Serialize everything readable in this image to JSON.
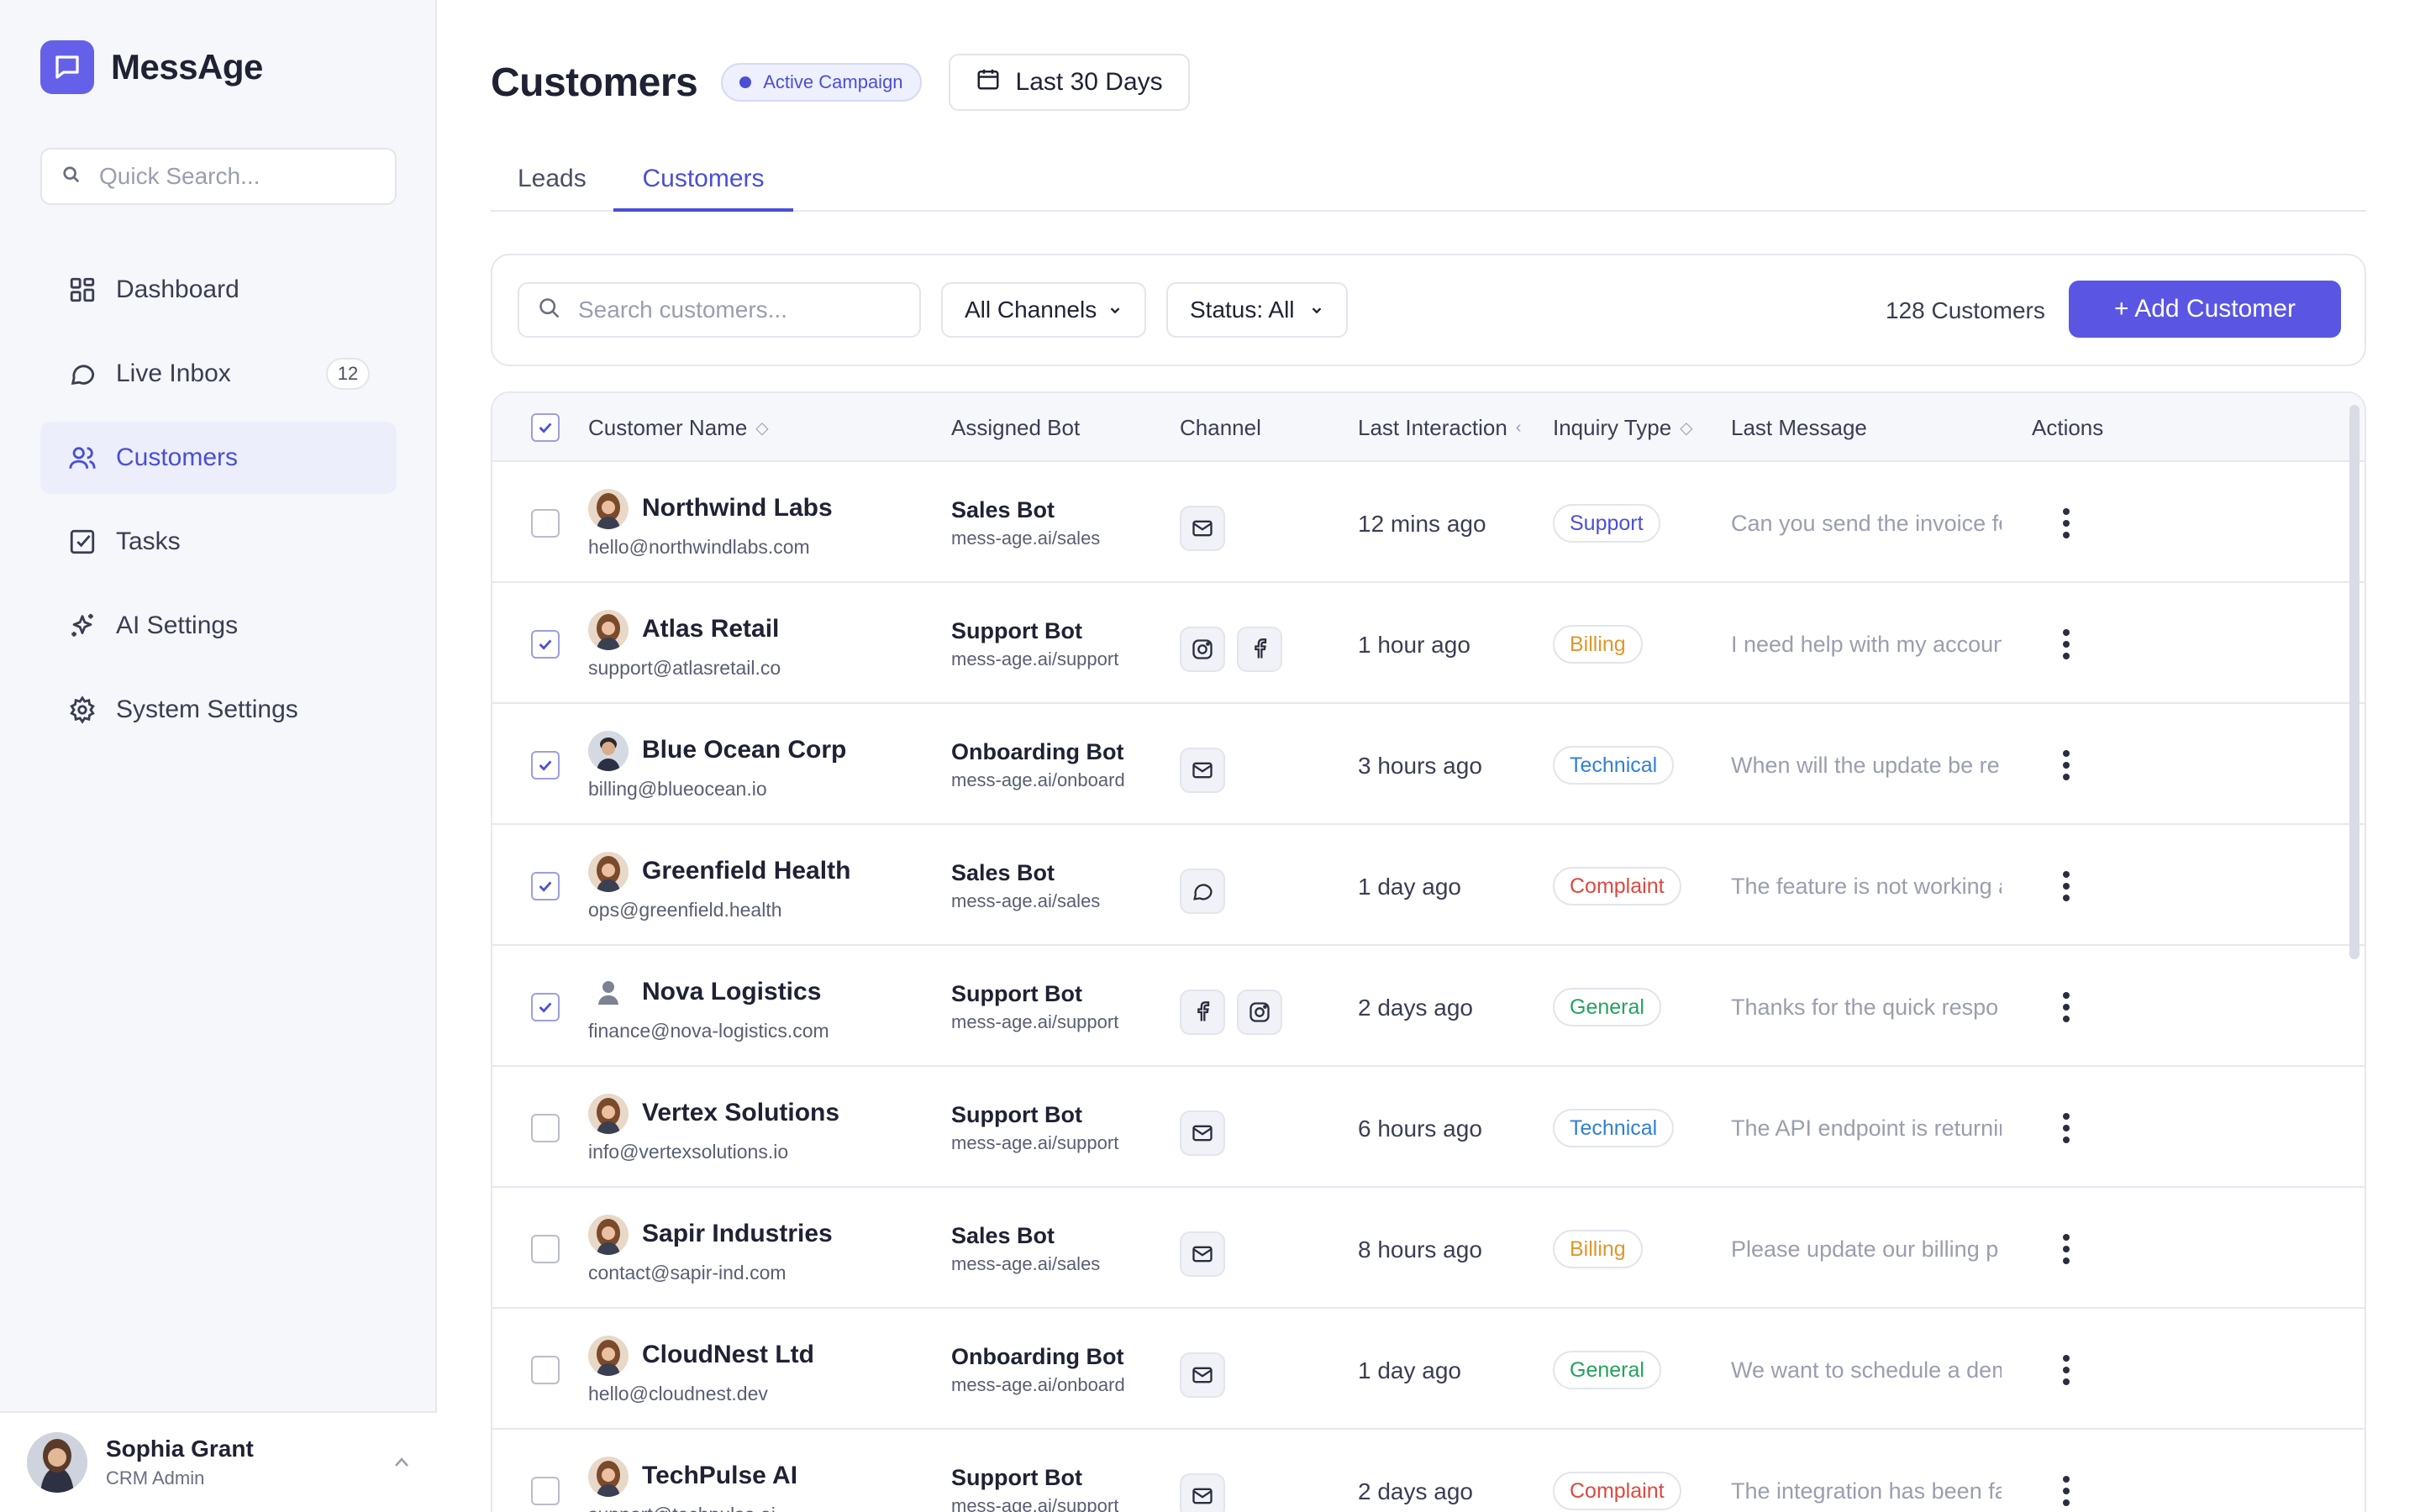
{
  "app": {
    "name": "MessAge"
  },
  "sidebar": {
    "search_placeholder": "Quick Search...",
    "items": [
      {
        "label": "Dashboard",
        "icon": "grid-icon"
      },
      {
        "label": "Live Inbox",
        "icon": "chat-icon",
        "badge": "12"
      },
      {
        "label": "Customers",
        "icon": "users-icon",
        "active": true
      },
      {
        "label": "Tasks",
        "icon": "checkbox-icon"
      },
      {
        "label": "AI Settings",
        "icon": "sparkles-icon"
      },
      {
        "label": "System Settings",
        "icon": "gear-icon"
      }
    ],
    "user": {
      "name": "Sophia Grant",
      "role": "CRM Admin"
    }
  },
  "header": {
    "title": "Customers",
    "campaign_badge": "Active Campaign",
    "date_range": "Last 30 Days"
  },
  "tabs": [
    {
      "label": "Leads",
      "active": false
    },
    {
      "label": "Customers",
      "active": true
    }
  ],
  "toolbar": {
    "search_placeholder": "Search customers...",
    "channel_filter": "All Channels",
    "status_filter": "Status: All",
    "count": "128 Customers",
    "add_label": "+ Add Customer"
  },
  "table": {
    "columns": [
      "Customer Name",
      "Assigned Bot",
      "Channel",
      "Last Interaction",
      "Inquiry Type",
      "Last Message",
      "Actions"
    ],
    "rows": [
      {
        "name": "Northwind Labs",
        "email": "hello@northwindlabs.com",
        "bot": "Sales Bot",
        "bot_url": "mess-age.ai/sales",
        "channels": [
          "mail-icon"
        ],
        "last": "12 mins ago",
        "type": "Support",
        "type_color": "#4a4fd6",
        "msg": "Can you send the invoice for",
        "checked": false,
        "avatar": "woman"
      },
      {
        "name": "Atlas Retail",
        "email": "support@atlasretail.co",
        "bot": "Support Bot",
        "bot_url": "mess-age.ai/support",
        "channels": [
          "instagram-icon",
          "facebook-icon"
        ],
        "last": "1 hour ago",
        "type": "Billing",
        "type_color": "#e0972a",
        "msg": "I need help with my account",
        "checked": true,
        "avatar": "woman"
      },
      {
        "name": "Blue Ocean Corp",
        "email": "billing@blueocean.io",
        "bot": "Onboarding Bot",
        "bot_url": "mess-age.ai/onboard",
        "channels": [
          "mail-icon"
        ],
        "last": "3 hours ago",
        "type": "Technical",
        "type_color": "#2f7fd8",
        "msg": "When will the update be re",
        "checked": true,
        "avatar": "man"
      },
      {
        "name": "Greenfield Health",
        "email": "ops@greenfield.health",
        "bot": "Sales Bot",
        "bot_url": "mess-age.ai/sales",
        "channels": [
          "chat-bubble-icon"
        ],
        "last": "1 day ago",
        "type": "Complaint",
        "type_color": "#e0463f",
        "msg": "The feature is not working as",
        "checked": true,
        "avatar": "woman"
      },
      {
        "name": "Nova Logistics",
        "email": "finance@nova-logistics.com",
        "bot": "Support Bot",
        "bot_url": "mess-age.ai/support",
        "channels": [
          "facebook-icon",
          "instagram-icon"
        ],
        "last": "2 days ago",
        "type": "General",
        "type_color": "#23a35d",
        "msg": "Thanks for the quick respo",
        "checked": true,
        "avatar": "person"
      },
      {
        "name": "Vertex Solutions",
        "email": "info@vertexsolutions.io",
        "bot": "Support Bot",
        "bot_url": "mess-age.ai/support",
        "channels": [
          "mail-icon"
        ],
        "last": "6 hours ago",
        "type": "Technical",
        "type_color": "#2f7fd8",
        "msg": "The API endpoint is returning",
        "checked": false,
        "avatar": "woman"
      },
      {
        "name": "Sapir Industries",
        "email": "contact@sapir-ind.com",
        "bot": "Sales Bot",
        "bot_url": "mess-age.ai/sales",
        "channels": [
          "mail-icon"
        ],
        "last": "8 hours ago",
        "type": "Billing",
        "type_color": "#e0972a",
        "msg": "Please update our billing p",
        "checked": false,
        "avatar": "woman"
      },
      {
        "name": "CloudNest Ltd",
        "email": "hello@cloudnest.dev",
        "bot": "Onboarding Bot",
        "bot_url": "mess-age.ai/onboard",
        "channels": [
          "mail-icon"
        ],
        "last": "1 day ago",
        "type": "General",
        "type_color": "#23a35d",
        "msg": "We want to schedule a demo",
        "checked": false,
        "avatar": "woman"
      },
      {
        "name": "TechPulse AI",
        "email": "support@techpulse.ai",
        "bot": "Support Bot",
        "bot_url": "mess-age.ai/support",
        "channels": [
          "mail-icon"
        ],
        "last": "2 days ago",
        "type": "Complaint",
        "type_color": "#e0463f",
        "msg": "The integration has been fa",
        "checked": false,
        "avatar": "woman"
      }
    ]
  },
  "colors": {
    "accent": "#5a56e3",
    "brand": "#6560e9"
  }
}
